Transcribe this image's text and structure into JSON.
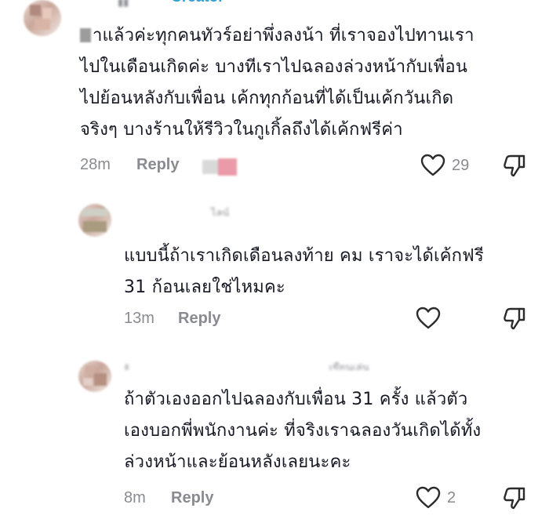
{
  "comments": [
    {
      "creator_label": "Creator",
      "lines": [
        "าแล้วค่ะทุกคนทัวร์อย่าพึ่งลงน้า ที่เราจองไปทานเรา",
        "ไปในเดือนเกิดค่ะ บางทีเราไปฉลองล่วงหน้ากับเพื่อน",
        "ไปย้อนหลังกับเพื่อน เค้กทุกก้อนที่ได้เป็นเค้กวันเกิด",
        "จริงๆ บางร้านให้รีวิวในกูเกิ้ลถึงได้เค้กฟรีค่า"
      ],
      "time": "28m",
      "reply_label": "Reply",
      "like_count": "29",
      "icons": [
        "heart-icon",
        "dislike-icon"
      ]
    },
    {
      "obscured_name": "ไลน์",
      "lines": [
        "แบบนี้ถ้าเราเกิดเดือนลงท้าย คม เราจะได้เค้กฟรี",
        "31 ก้อนเลยใช่ไหมคะ"
      ],
      "time": "13m",
      "reply_label": "Reply",
      "like_count": "",
      "icons": [
        "heart-icon",
        "dislike-icon"
      ]
    },
    {
      "obscured_name": "เขียนเล่น",
      "lines": [
        "ถ้าตัวเองออกไปฉลองกับเพื่อน 31 ครั้ง แล้วตัว",
        "เองบอกพี่พนักงานค่ะ ที่จริงเราฉลองวันเกิดได้ทั้ง",
        "ล่วงหน้าและย้อนหลังเลยนะคะ"
      ],
      "time": "8m",
      "reply_label": "Reply",
      "like_count": "2",
      "icons": [
        "heart-icon",
        "dislike-icon"
      ]
    }
  ],
  "colors": {
    "text": "#161823",
    "meta": "#8a8b91",
    "creator": "#2f9fd6"
  }
}
